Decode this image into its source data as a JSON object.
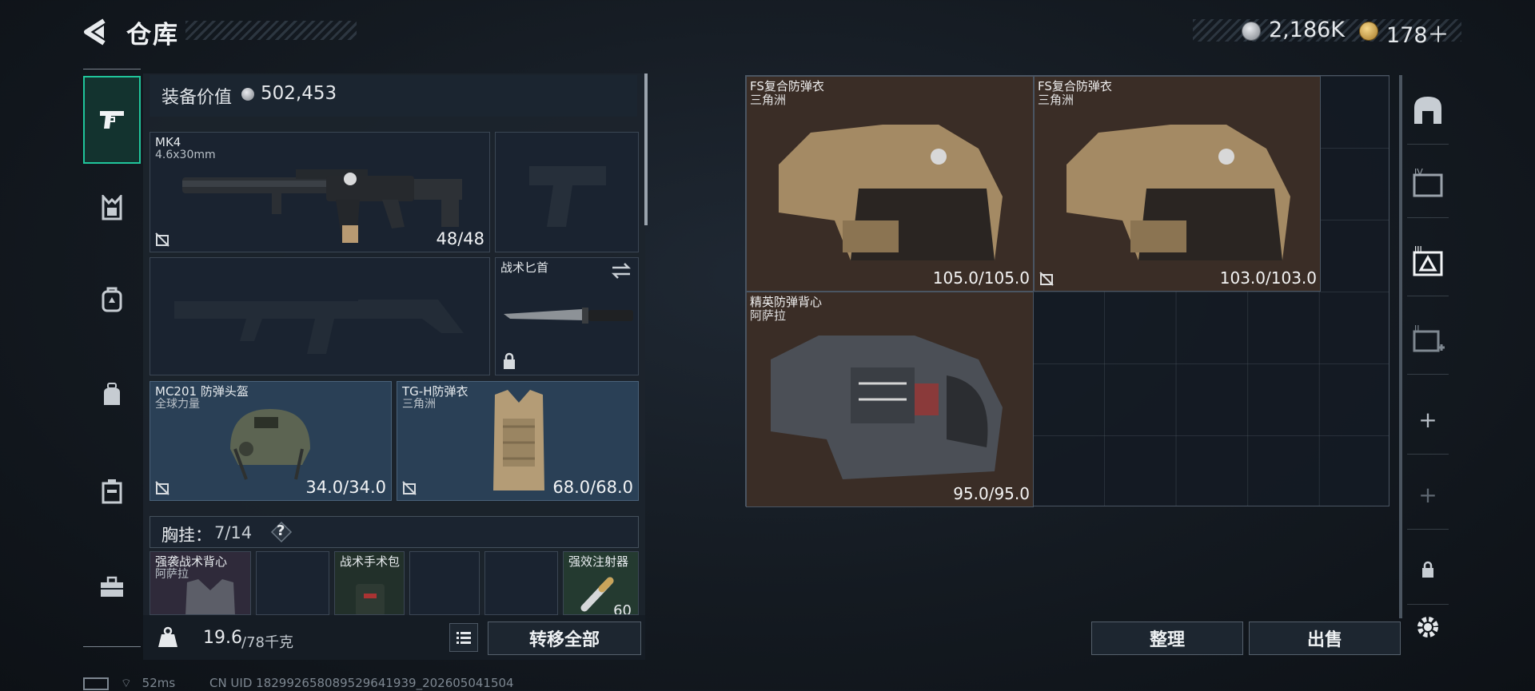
{
  "header": {
    "title": "仓库",
    "currency_1": "2,186K",
    "currency_2": "178＋"
  },
  "categories": [
    "pistol-icon",
    "armor-icon",
    "backpack-icon",
    "bag-icon",
    "container-icon",
    "toolbox-icon"
  ],
  "equipment": {
    "value_label": "装备价值",
    "value": "502,453",
    "primary_weapon": {
      "name": "MK4",
      "ammo": "4.6x30mm",
      "count": "48/48"
    },
    "knife": {
      "name": "战术匕首"
    },
    "helmet": {
      "name": "MC201 防弹头盔",
      "brand": "全球力量",
      "durability": "34.0/34.0"
    },
    "armor": {
      "name": "TG-H防弹衣",
      "brand": "三角洲",
      "durability": "68.0/68.0"
    },
    "chest_rig": {
      "label": "胸挂：",
      "count": "7/14",
      "help": "?"
    },
    "rig_items": [
      {
        "name": "强袭战术背心",
        "brand": "阿萨拉"
      },
      {
        "name": "战术手术包"
      },
      {
        "name": "强效注射器",
        "count": "60"
      }
    ],
    "weight": "19.6",
    "weight_cap": "/78千克",
    "transfer_all": "转移全部"
  },
  "storage": {
    "items": [
      {
        "name": "FS复合防弹衣",
        "brand": "三角洲",
        "durability": "105.0/105.0"
      },
      {
        "name": "FS复合防弹衣",
        "brand": "三角洲",
        "durability": "103.0/103.0"
      },
      {
        "name": "精英防弹背心",
        "brand": "阿萨拉",
        "durability": "95.0/95.0"
      }
    ],
    "sort_button": "整理",
    "sell_button": "出售"
  },
  "right_rail": {
    "add": "+",
    "add2": "+"
  },
  "status_bar": {
    "ping": "52ms",
    "uid": "CN UID 18299265808952964193​9_202605041504"
  },
  "colors": {
    "accent": "#20c59b",
    "panel": "#1c242d",
    "item_bg": "#3a2d26"
  }
}
